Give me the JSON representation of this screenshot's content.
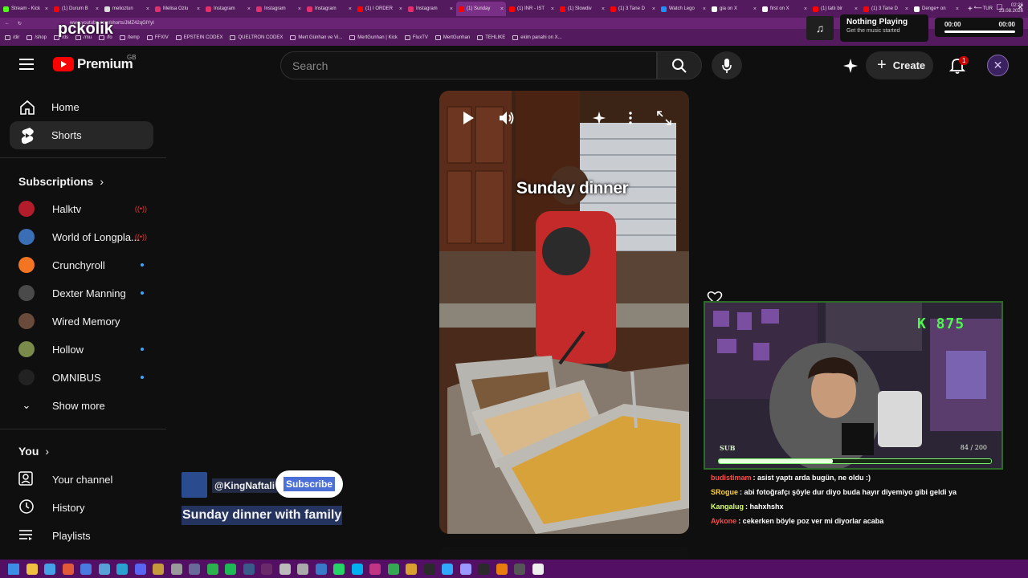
{
  "browser": {
    "tabs": [
      {
        "label": "Stream - Kick",
        "color": "#53fc18",
        "active": false
      },
      {
        "label": "(1) Durum B",
        "color": "#ff0000",
        "active": false
      },
      {
        "label": "melioztun",
        "color": "#dddddd",
        "active": false
      },
      {
        "label": "Melisa Ozlu",
        "color": "#e1306c",
        "active": false
      },
      {
        "label": "Instagram",
        "color": "#e1306c",
        "active": false
      },
      {
        "label": "Instagram",
        "color": "#e1306c",
        "active": false
      },
      {
        "label": "Instagram",
        "color": "#e1306c",
        "active": false
      },
      {
        "label": "(1) I ORDER",
        "color": "#ff0000",
        "active": false
      },
      {
        "label": "Instagram",
        "color": "#e1306c",
        "active": false
      },
      {
        "label": "(1) Sunday",
        "color": "#ff0000",
        "active": true
      },
      {
        "label": "(1) INR - IST",
        "color": "#ff0000",
        "active": false
      },
      {
        "label": "(1) Slowdiv",
        "color": "#ff0000",
        "active": false
      },
      {
        "label": "(1) 3 Tane D",
        "color": "#ff0000",
        "active": false
      },
      {
        "label": "Watch Lego",
        "color": "#1e90ff",
        "active": false
      },
      {
        "label": "gia on X",
        "color": "#ffffff",
        "active": false
      },
      {
        "label": "first on X",
        "color": "#ffffff",
        "active": false
      },
      {
        "label": "(1) tatlı bir",
        "color": "#ff0000",
        "active": false
      },
      {
        "label": "(1) 3 Tane D",
        "color": "#ff0000",
        "active": false
      },
      {
        "label": "Denge+ on",
        "color": "#ffffff",
        "active": false
      }
    ],
    "new_tab": "+",
    "url": "www.youtube.com/shorts/JMZ42qGlYyI",
    "bookmarks": [
      "/dir",
      "/shop",
      "/ds",
      "/mu",
      "/fo",
      "/temp",
      "FFXIV",
      "EPSTEIN CODEX",
      "QUELTRON CODEX",
      "Mert Günhan ve Vi...",
      "MertGunhan | Kick",
      "FluxTV",
      "MertGunhan",
      "TEHLIKE",
      "ekim panahi on X..."
    ],
    "watermark": "pckolik"
  },
  "now_playing": {
    "title": "Nothing Playing",
    "subtitle": "Get the music started",
    "time_current": "00:00",
    "time_total": "00:00"
  },
  "header": {
    "logo_text": "Premium",
    "country": "GB",
    "search_placeholder": "Search",
    "create_label": "Create",
    "notif_count": "1"
  },
  "sidebar": {
    "nav": [
      {
        "label": "Home",
        "icon": "home-icon",
        "active": false
      },
      {
        "label": "Shorts",
        "icon": "shorts-icon",
        "active": true
      }
    ],
    "subscriptions_title": "Subscriptions",
    "subscriptions": [
      {
        "label": "Halktv",
        "color": "#b31c2a",
        "badge": "live"
      },
      {
        "label": "World of Longpla...",
        "color": "#3b6fb5",
        "badge": "live"
      },
      {
        "label": "Crunchyroll",
        "color": "#f47521",
        "badge": "dot"
      },
      {
        "label": "Dexter Manning",
        "color": "#4a4a4a",
        "badge": "dot"
      },
      {
        "label": "Wired Memory",
        "color": "#6a4a3a",
        "badge": ""
      },
      {
        "label": "Hollow",
        "color": "#7a8a4a",
        "badge": "dot"
      },
      {
        "label": "OMNIBUS",
        "color": "#222222",
        "badge": "dot"
      }
    ],
    "show_more": "Show more",
    "you_title": "You",
    "you_items": [
      {
        "label": "Your channel",
        "icon": "channel-icon"
      },
      {
        "label": "History",
        "icon": "history-icon"
      },
      {
        "label": "Playlists",
        "icon": "playlists-icon"
      }
    ]
  },
  "short": {
    "caption": "Sunday dinner",
    "channel": "@KingNaftali",
    "subscribe": "Subscribe",
    "title": "Sunday dinner with family"
  },
  "stream_overlay": {
    "counter": "K 875",
    "sub_label": "SUB",
    "sub_count": "84 / 200",
    "sub_progress": 0.42
  },
  "chat": [
    {
      "user": "budistimam",
      "color": "#ff4a4a",
      "text": ": asist yaptı arda bugün, ne oldu :)"
    },
    {
      "user": "SRogue",
      "color": "#ffd23f",
      "text": ": abi fotoğrafçı şöyle dur diyo buda hayır diyemiyo gibi geldi ya"
    },
    {
      "user": "Kangalug",
      "color": "#d9ff6a",
      "text": ": hahxhshx"
    },
    {
      "user": "Aykone",
      "color": "#ff4a4a",
      "text": ": cekerken böyle poz ver mi diyorlar acaba"
    }
  ],
  "taskbar": {
    "icons": [
      "windows-logo",
      "file-explorer",
      "photos",
      "paint",
      "store",
      "notepad",
      "edge",
      "discord",
      "ffxiv",
      "settings",
      "steam-deck",
      "xbox",
      "spotify",
      "steam",
      "obs",
      "clock-app",
      "audio-app",
      "wordpad",
      "whatsapp",
      "skype",
      "instagram",
      "chrome",
      "maps",
      "epic-games",
      "photoshop",
      "premiere",
      "stream-deck",
      "blender",
      "camera",
      "github"
    ],
    "tray": [
      "TUR"
    ],
    "time": "02:26",
    "date": "23.08.2026"
  }
}
